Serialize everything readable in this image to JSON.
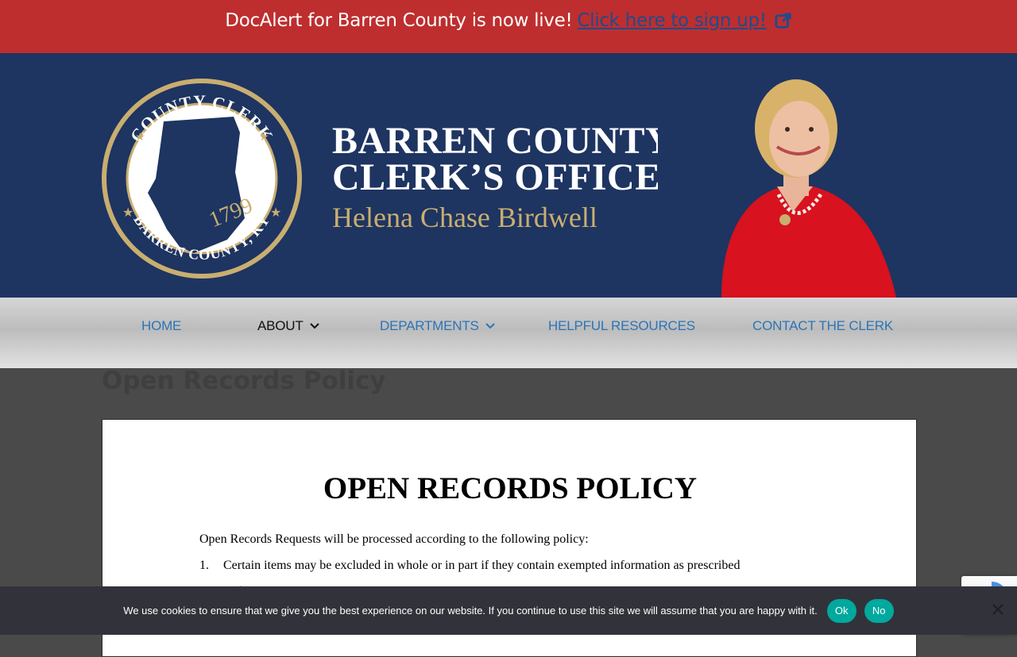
{
  "alert": {
    "text": "DocAlert for Barren County is now live!",
    "link": "Click here to sign up!",
    "icon": "external-link-icon"
  },
  "banner": {
    "seal": {
      "top_text": "COUNTY CLERK",
      "bottom_text": "BARREN COUNTY, KY",
      "year": "1799"
    },
    "title_line1": "BARREN COUNTY",
    "title_line2": "CLERK’S OFFICE",
    "name": "Helena Chase Birdwell"
  },
  "nav": {
    "items": [
      {
        "label": "HOME"
      },
      {
        "label": "ABOUT"
      },
      {
        "label": "DEPARTMENTS"
      },
      {
        "label": "HELPFUL RESOURCES"
      },
      {
        "label": "CONTACT THE CLERK"
      }
    ]
  },
  "page": {
    "title": "Open Records Policy"
  },
  "document": {
    "heading": "OPEN RECORDS POLICY",
    "intro": "Open Records Requests will be processed according to the following policy:",
    "item1_num": "1.",
    "item1_text": "Certain items may be excluded in whole or in part if they contain exempted information as prescribed",
    "item1_cont": "under"
  },
  "cookie": {
    "text": "We use cookies to ensure that we give you the best experience on our website. If you continue to use this site we will assume that you are happy with it.",
    "ok_label": "Ok",
    "no_label": "No"
  },
  "colors": {
    "alert_bg": "#be2e2e",
    "banner_bg": "#1e3461",
    "nav_link": "#2c74b8",
    "cookie_btn": "#00a99d"
  }
}
